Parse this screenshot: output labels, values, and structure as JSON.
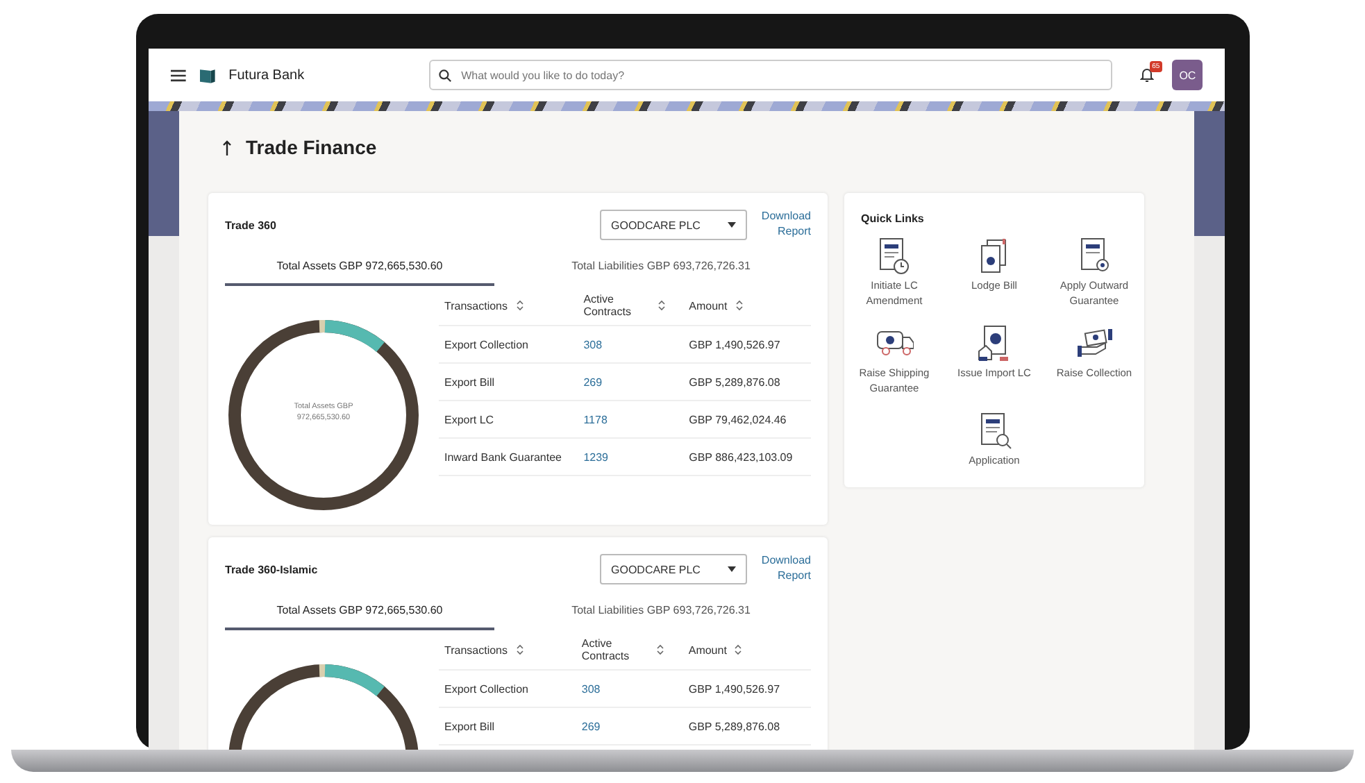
{
  "header": {
    "brand": "Futura Bank",
    "search": {
      "placeholder": "What would you like to do today?"
    },
    "notification_badge": "65",
    "avatar": "OC"
  },
  "page": {
    "title": "Trade Finance"
  },
  "cards": [
    {
      "title": "Trade 360",
      "party": "GOODCARE PLC",
      "download": "Download Report",
      "tabs": [
        {
          "label": "Total Assets GBP 972,665,530.60",
          "selected": true
        },
        {
          "label": "Total Liabilities GBP 693,726,726.31",
          "selected": false
        }
      ],
      "donut_center": "Total Assets GBP 972,665,530.60",
      "columns": [
        "Transactions",
        "Active Contracts",
        "Amount"
      ],
      "rows": [
        {
          "transaction": "Export Collection",
          "contracts": "308",
          "amount": "GBP 1,490,526.97"
        },
        {
          "transaction": "Export Bill",
          "contracts": "269",
          "amount": "GBP 5,289,876.08"
        },
        {
          "transaction": "Export LC",
          "contracts": "1178",
          "amount": "GBP 79,462,024.46"
        },
        {
          "transaction": "Inward Bank Guarantee",
          "contracts": "1239",
          "amount": "GBP 886,423,103.09"
        }
      ]
    },
    {
      "title": "Trade 360-Islamic",
      "party": "GOODCARE PLC",
      "download": "Download Report",
      "tabs": [
        {
          "label": "Total Assets GBP 972,665,530.60",
          "selected": true
        },
        {
          "label": "Total Liabilities GBP 693,726,726.31",
          "selected": false
        }
      ],
      "columns": [
        "Transactions",
        "Active Contracts",
        "Amount"
      ],
      "rows": [
        {
          "transaction": "Export Collection",
          "contracts": "308",
          "amount": "GBP 1,490,526.97"
        },
        {
          "transaction": "Export Bill",
          "contracts": "269",
          "amount": "GBP 5,289,876.08"
        }
      ]
    }
  ],
  "quick_links": {
    "title": "Quick Links",
    "items": [
      {
        "label": "Initiate LC Amendment"
      },
      {
        "label": "Lodge Bill"
      },
      {
        "label": "Apply Outward Guarantee"
      },
      {
        "label": "Raise Shipping Guarantee"
      },
      {
        "label": "Issue Import LC"
      },
      {
        "label": "Raise Collection"
      },
      {
        "label": "Application"
      }
    ]
  }
}
